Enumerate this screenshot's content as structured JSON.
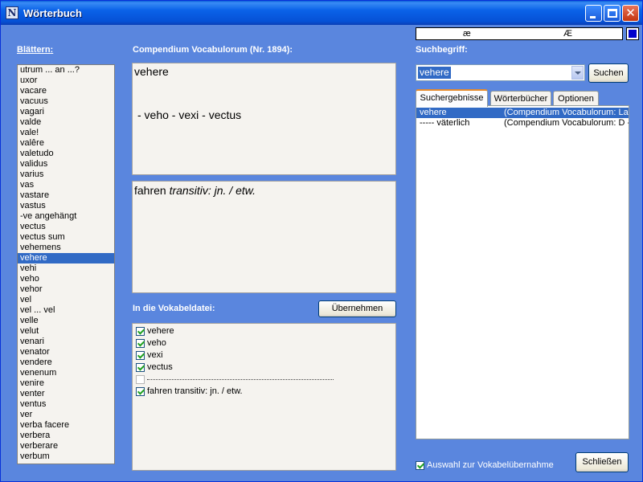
{
  "window": {
    "title": "Wörterbuch",
    "app_icon": "N"
  },
  "char_bar": {
    "chars": [
      "æ",
      "Æ"
    ]
  },
  "browse": {
    "label": "Blättern:",
    "items": [
      "utrum ... an ...?",
      "uxor",
      "vacare",
      "vacuus",
      "vagari",
      "valde",
      "vale!",
      "valêre",
      "valetudo",
      "validus",
      "varius",
      "vas",
      "vastare",
      "vastus",
      "-ve angehängt",
      "vectus",
      "vectus sum",
      "vehemens",
      "vehere",
      "vehi",
      "veho",
      "vehor",
      "vel",
      "vel ... vel",
      "velle",
      "velut",
      "venari",
      "venator",
      "vendere",
      "venenum",
      "venire",
      "venter",
      "ventus",
      "ver",
      "verba facere",
      "verbera",
      "verberare",
      "verbum"
    ],
    "selected_index": 18
  },
  "entry": {
    "label": "Compendium Vocabulorum (Nr. 1894):",
    "word": "vehere",
    "forms": "- veho - vexi - vectus",
    "translation_plain": "fahren ",
    "translation_italic": "transitiv: jn. / etw."
  },
  "vocab": {
    "label": "In die Vokabeldatei:",
    "take_button": "Übernehmen",
    "items": [
      {
        "text": "vehere",
        "checked": true
      },
      {
        "text": "veho",
        "checked": true
      },
      {
        "text": "vexi",
        "checked": true
      },
      {
        "text": "vectus",
        "checked": true
      },
      {
        "text": "",
        "checked": false
      },
      {
        "text": "fahren transitiv: jn. / etw.",
        "checked": true
      }
    ]
  },
  "search": {
    "label": "Suchbegriff:",
    "value": "vehere",
    "button": "Suchen"
  },
  "tabs": [
    "Suchergebnisse",
    "Wörterbücher",
    "Optionen"
  ],
  "results": [
    {
      "word": "vehere",
      "source": "(Compendium Vocabulorum: Late",
      "selected": true
    },
    {
      "word": "-----  väterlich",
      "source": "(Compendium Vocabulorum: D ->",
      "selected": false
    }
  ],
  "footer": {
    "checkbox_label": "Auswahl zur Vokabelübernahme",
    "checked": true,
    "close_button": "Schließen"
  },
  "colors": {
    "accent": "#316ac5",
    "window_bg": "#5a86de",
    "title_bar": "#0a62e8"
  }
}
